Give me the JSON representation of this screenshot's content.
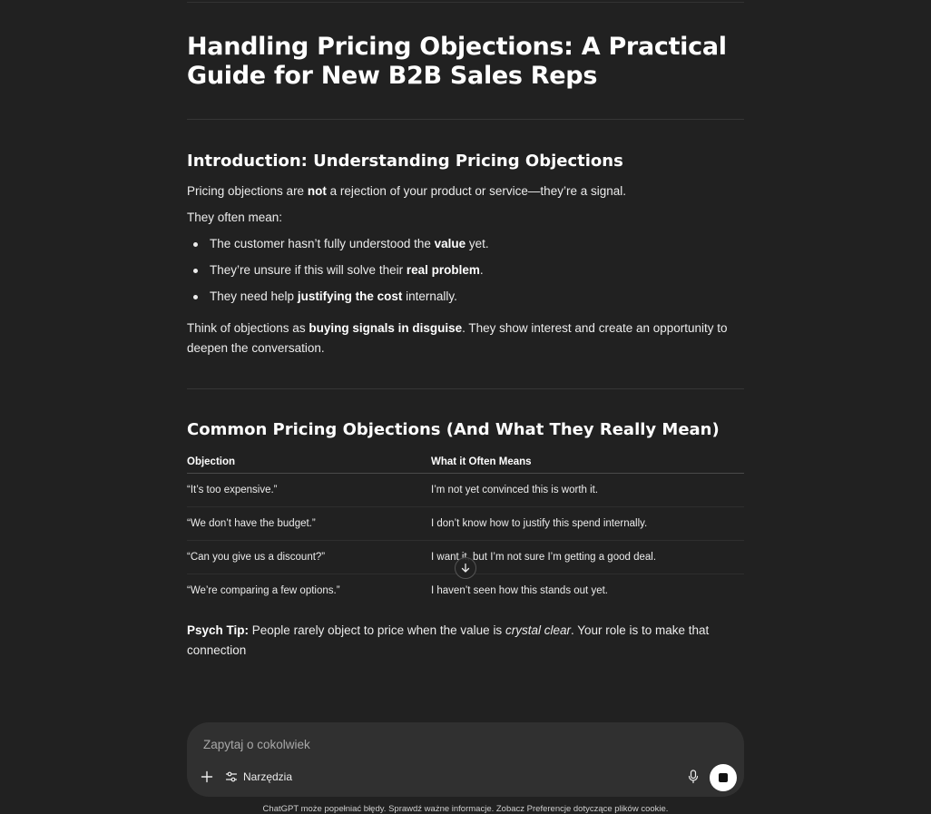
{
  "article": {
    "title": "Handling Pricing Objections: A Practical Guide for New B2B Sales Reps",
    "intro_heading": "Introduction: Understanding Pricing Objections",
    "intro_p1_before": "Pricing objections are ",
    "intro_p1_bold": "not",
    "intro_p1_after": " a rejection of your product or service—they’re a signal.",
    "intro_p2": "They often mean:",
    "bullets": [
      {
        "before": "The customer hasn’t fully understood the ",
        "bold": "value",
        "after": " yet."
      },
      {
        "before": "They’re unsure if this will solve their ",
        "bold": "real problem",
        "after": "."
      },
      {
        "before": "They need help ",
        "bold": "justifying the cost",
        "after": " internally."
      }
    ],
    "intro_p3_before": "Think of objections as ",
    "intro_p3_bold": "buying signals in disguise",
    "intro_p3_after": ". They show interest and create an opportunity to deepen the conversation.",
    "common_heading": "Common Pricing Objections (And What They Really Mean)",
    "table": {
      "headers": [
        "Objection",
        "What it Often Means"
      ],
      "rows": [
        [
          "“It’s too expensive.”",
          "I’m not yet convinced this is worth it."
        ],
        [
          "“We don’t have the budget.”",
          "I don’t know how to justify this spend internally."
        ],
        [
          "“Can you give us a discount?”",
          "I want it, but I’m not sure I’m getting a good deal."
        ],
        [
          "“We’re comparing a few options.”",
          "I haven’t seen how this stands out yet."
        ]
      ]
    },
    "tip_label": "Psych Tip:",
    "tip_before": " People rarely object to price when the value is ",
    "tip_italic": "crystal clear",
    "tip_after": ". Your role is to make that connection"
  },
  "composer": {
    "placeholder": "Zapytaj o cokolwiek",
    "tools_label": "Narzędzia"
  },
  "footer": "ChatGPT może popełniać błędy. Sprawdź ważne informacje. Zobacz Preferencje dotyczące plików cookie.",
  "icons": [
    "plus-icon",
    "tools-sliders-icon",
    "microphone-icon",
    "stop-icon",
    "arrow-down-icon"
  ]
}
